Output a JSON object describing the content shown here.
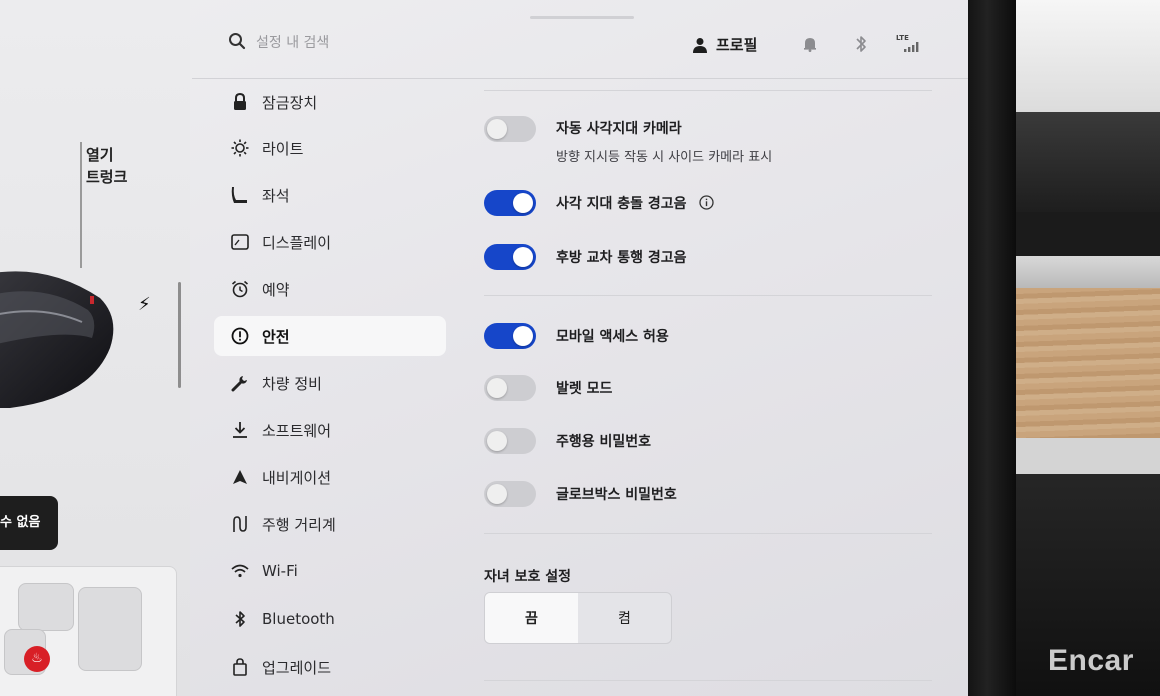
{
  "search": {
    "placeholder": "설정 내 검색"
  },
  "header": {
    "profile_label": "프로필",
    "signal_label": "LTE"
  },
  "car_panel": {
    "open_label_line1": "열기",
    "open_label_line2": "트렁크",
    "status_chip": "수 없음"
  },
  "sidebar": {
    "items": [
      {
        "label": "잠금장치",
        "icon": "lock-icon"
      },
      {
        "label": "라이트",
        "icon": "light-icon"
      },
      {
        "label": "좌석",
        "icon": "seat-icon"
      },
      {
        "label": "디스플레이",
        "icon": "display-icon"
      },
      {
        "label": "예약",
        "icon": "alarm-clock-icon"
      },
      {
        "label": "안전",
        "icon": "safety-icon",
        "active": true
      },
      {
        "label": "차량 정비",
        "icon": "wrench-icon"
      },
      {
        "label": "소프트웨어",
        "icon": "download-icon"
      },
      {
        "label": "내비게이션",
        "icon": "navigation-icon"
      },
      {
        "label": "주행 거리계",
        "icon": "trip-icon"
      },
      {
        "label": "Wi-Fi",
        "icon": "wifi-icon"
      },
      {
        "label": "Bluetooth",
        "icon": "bluetooth-icon"
      },
      {
        "label": "업그레이드",
        "icon": "shopping-bag-icon"
      }
    ]
  },
  "settings": {
    "blind_spot_camera": {
      "title": "자동 사각지대 카메라",
      "subtitle": "방향 지시등 작동 시 사이드 카메라 표시",
      "enabled": false
    },
    "blind_spot_warning": {
      "title": "사각 지대 충돌 경고음",
      "enabled": true
    },
    "rear_cross_traffic": {
      "title": "후방 교차 통행 경고음",
      "enabled": true
    },
    "mobile_access": {
      "title": "모바일 액세스 허용",
      "enabled": true
    },
    "valet_mode": {
      "title": "발렛 모드",
      "enabled": false
    },
    "pin_to_drive": {
      "title": "주행용 비밀번호",
      "enabled": false
    },
    "glovebox_pin": {
      "title": "글로브박스 비밀번호",
      "enabled": false
    }
  },
  "child_lock": {
    "title": "자녀 보호 설정",
    "options": [
      "끔",
      "켬"
    ],
    "selected": "끔"
  },
  "watermark": "Encar",
  "colors": {
    "accent": "#1646c9",
    "alert": "#d81f26"
  }
}
